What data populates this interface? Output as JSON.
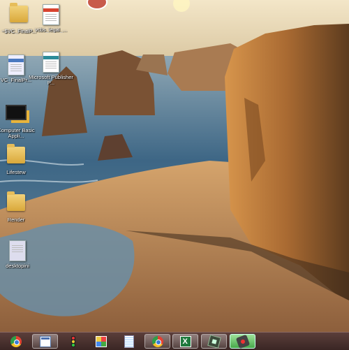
{
  "desktop": {
    "icons": [
      {
        "label": "~$VC_FinalP...",
        "kind": "folder"
      },
      {
        "label": "vcbs_legal_...",
        "kind": "document"
      },
      {
        "label": "VC_FinalPr...",
        "kind": "image"
      },
      {
        "label": "Microsoft Publisher P...",
        "kind": "document"
      },
      {
        "label": "Computer Basic Appli...",
        "kind": "app"
      },
      {
        "label": "Lifestew",
        "kind": "folder"
      },
      {
        "label": "Render",
        "kind": "folder"
      },
      {
        "label": "desktopini",
        "kind": "file"
      }
    ]
  },
  "taskbar": {
    "buttons": [
      {
        "name": "chrome",
        "icon": "chrome-icon"
      },
      {
        "name": "window",
        "icon": "window-icon"
      },
      {
        "name": "traffic-light",
        "icon": "traffic-light-icon"
      },
      {
        "name": "grid",
        "icon": "grid-icon"
      },
      {
        "name": "notepad",
        "icon": "notepad-icon"
      },
      {
        "name": "chrome-2",
        "icon": "chrome-icon"
      },
      {
        "name": "excel",
        "icon": "excel-icon"
      },
      {
        "name": "media",
        "icon": "media-icon"
      },
      {
        "name": "recorder",
        "icon": "recorder-icon"
      }
    ]
  },
  "colors": {
    "taskbar": "#3a2624",
    "highlight": "#47a84a",
    "sky": "#e9d9b8",
    "sea": "#2e5878",
    "sand": "#c9935c",
    "cliff": "#b9783a"
  }
}
